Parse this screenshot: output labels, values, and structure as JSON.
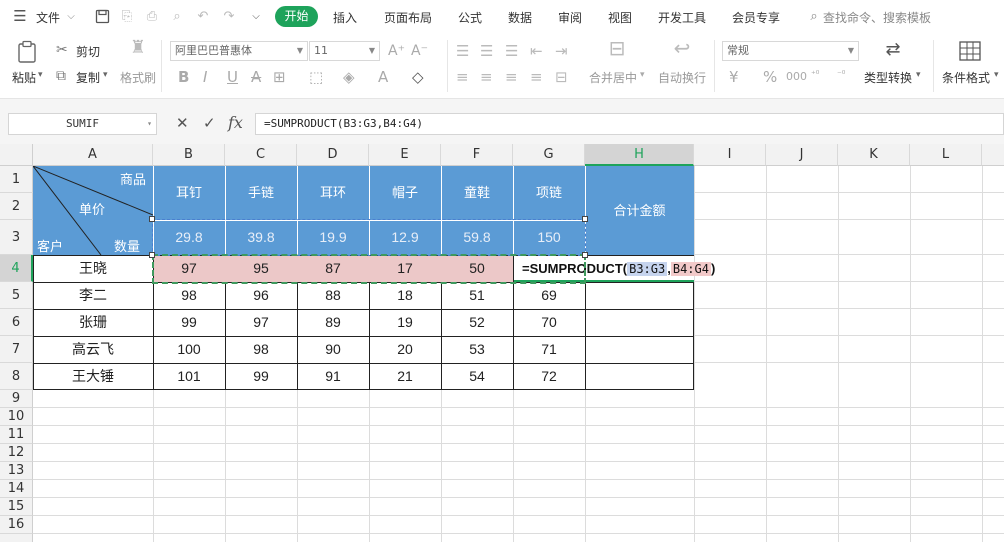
{
  "menu": {
    "file": "文件",
    "tabs": [
      "开始",
      "插入",
      "页面布局",
      "公式",
      "数据",
      "审阅",
      "视图",
      "开发工具",
      "会员专享"
    ],
    "search_placeholder": "查找命令、搜索模板"
  },
  "ribbon": {
    "cut": "剪切",
    "paste": "粘贴",
    "copy": "复制",
    "format_painter": "格式刷",
    "font_name": "阿里巴巴普惠体",
    "font_size": "11",
    "number_format": "常规",
    "merge_center": "合并居中",
    "wrap_text": "自动换行",
    "type_convert": "类型转换",
    "conditional_format": "条件格式"
  },
  "formula_bar": {
    "name_box": "SUMIF",
    "fx": "fx",
    "formula": "=SUMPRODUCT(B3:G3,B4:G4)"
  },
  "columns": [
    "A",
    "B",
    "C",
    "D",
    "E",
    "F",
    "G",
    "H",
    "I",
    "J",
    "K",
    "L"
  ],
  "rows": [
    "1",
    "2",
    "3",
    "4",
    "5",
    "6",
    "7",
    "8",
    "9",
    "10",
    "11",
    "12",
    "13",
    "14",
    "15",
    "16"
  ],
  "header": {
    "product": "商品",
    "price": "单价",
    "customer": "客户",
    "quantity": "数量",
    "items": [
      "耳钉",
      "手链",
      "耳环",
      "帽子",
      "童鞋",
      "项链"
    ],
    "total": "合计金额",
    "prices": [
      "29.8",
      "39.8",
      "19.9",
      "12.9",
      "59.8",
      "150"
    ]
  },
  "data_rows": [
    {
      "name": "王晓",
      "values": [
        "97",
        "95",
        "87",
        "17",
        "50"
      ]
    },
    {
      "name": "李二",
      "values": [
        "98",
        "96",
        "88",
        "18",
        "51",
        "69"
      ]
    },
    {
      "name": "张珊",
      "values": [
        "99",
        "97",
        "89",
        "19",
        "52",
        "70"
      ]
    },
    {
      "name": "高云飞",
      "values": [
        "100",
        "98",
        "90",
        "20",
        "53",
        "71"
      ]
    },
    {
      "name": "王大锤",
      "values": [
        "101",
        "99",
        "91",
        "21",
        "54",
        "72"
      ]
    }
  ],
  "edit_cell": {
    "prefix": "=SUMPRODUCT(",
    "ref1": "B3:G3",
    "comma": ",",
    "ref2": "B4:G4",
    "suffix": ")"
  },
  "colors": {
    "accent": "#1ea35b",
    "header_blue": "#5b9bd5",
    "price_text": "#e7eef8",
    "row4_fill": "#ecc8c8",
    "ref1_highlight": "#c6d4ee",
    "ref2_highlight": "#f2c9c9",
    "selected_col": "#d4d4d4"
  }
}
